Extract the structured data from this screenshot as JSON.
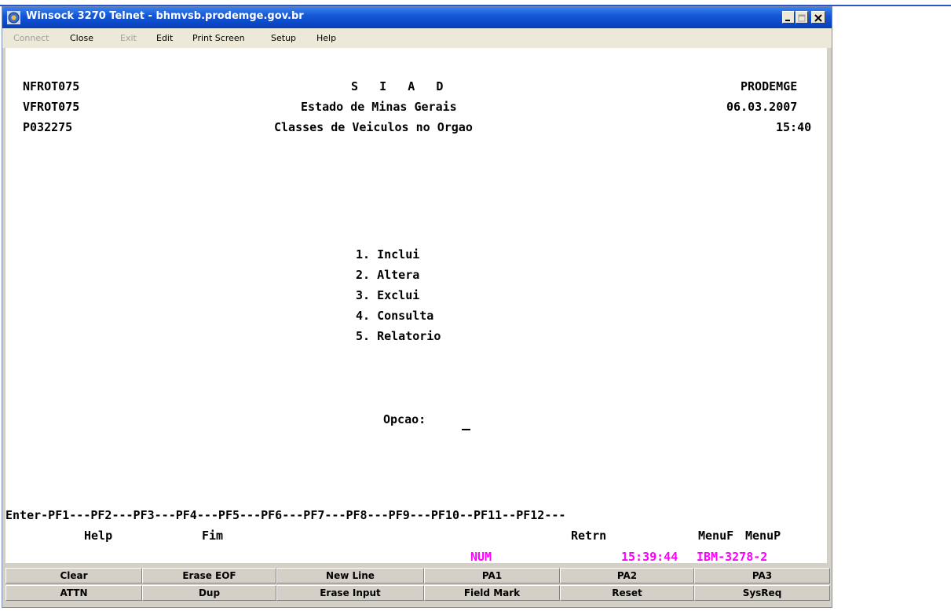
{
  "window": {
    "title": "Winsock 3270 Telnet - bhmvsb.prodemge.gov.br"
  },
  "menu": {
    "connect": "Connect",
    "close": "Close",
    "exit": "Exit",
    "edit": "Edit",
    "print_screen": "Print Screen",
    "setup": "Setup",
    "help": "Help"
  },
  "screen": {
    "header": {
      "left": [
        "NFROT075",
        "VFROT075",
        "P032275"
      ],
      "center": [
        "S   I   A   D",
        "Estado de Minas Gerais",
        "Classes de Veiculos no Orgao"
      ],
      "right": [
        "PRODEMGE",
        "06.03.2007",
        "15:40"
      ]
    },
    "options": [
      "1. Inclui",
      "2. Altera",
      "3. Exclui",
      "4. Consulta",
      "5. Relatorio"
    ],
    "prompt": "Opcao:",
    "pf_line": "Enter-PF1---PF2---PF3---PF4---PF5---PF6---PF7---PF8---PF9---PF10--PF11--PF12---",
    "pf_labels": {
      "help": "Help",
      "fim": "Fim",
      "retrn": "Retrn",
      "menuf": "MenuF",
      "menup": "MenuP"
    }
  },
  "status": {
    "num": "NUM",
    "time": "15:39:44",
    "terminal_type": "IBM-3278-2"
  },
  "keypad": {
    "row1": [
      "Clear",
      "Erase EOF",
      "New Line",
      "PA1",
      "PA2",
      "PA3"
    ],
    "row2": [
      "ATTN",
      "Dup",
      "Erase Input",
      "Field Mark",
      "Reset",
      "SysReq"
    ]
  },
  "colors": {
    "titlebar": "#0b48c8",
    "status_text": "#ff00ff"
  }
}
